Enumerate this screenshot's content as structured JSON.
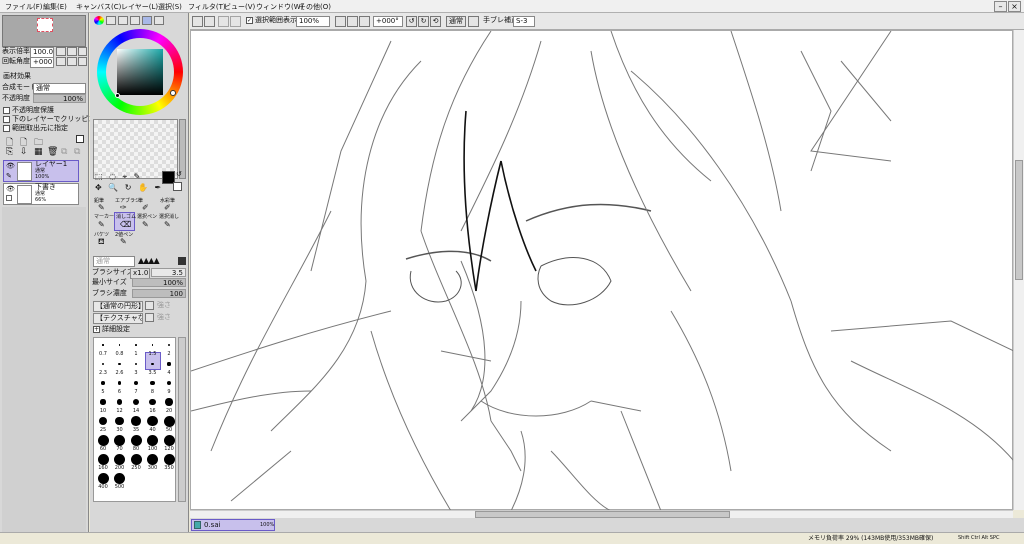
{
  "menu": [
    "ファイル(F)",
    "編集(E)",
    "キャンバス(C)",
    "レイヤー(L)",
    "選択(S)",
    "フィルタ(T)",
    "ビュー(V)",
    "ウィンドウ(W)",
    "その他(O)"
  ],
  "nav": {
    "zoom_label": "表示倍率",
    "zoom_value": "100.0%",
    "rotate_label": "回転角度",
    "rotate_value": "+000°"
  },
  "layer_panel": {
    "title": "画材効果",
    "blend_label": "合成モード",
    "blend_value": "通常",
    "opacity_label": "不透明度",
    "opacity_value": "100%",
    "opt1": "不透明度保護",
    "opt2": "下のレイヤーでクリッピング",
    "opt3": "範囲取出元に指定",
    "layers": [
      {
        "name": "レイヤー1",
        "mode": "通常",
        "opacity": "100%"
      },
      {
        "name": "下書き",
        "mode": "通常",
        "opacity": "66%"
      }
    ]
  },
  "tools": {
    "select_icons": "⬚ ◌ ⌖ ✎",
    "nav_icons": "✥ 🔍 ↻ ✋ ✒",
    "brushes_row1": [
      "鉛筆",
      "エアブラシ",
      "筆",
      "水彩筆"
    ],
    "brushes_row2": [
      "マーカー",
      "消しゴム",
      "選択ペン",
      "選択消し"
    ],
    "brushes_row3": [
      "バケツ",
      "2値ペン"
    ],
    "normal_label": "通常",
    "brush_size_label": "ブラシサイズ",
    "brush_size_mult": "x1.0",
    "brush_size_value": "3.5",
    "min_size_label": "最小サイズ",
    "min_size_value": "100%",
    "density_label": "ブラシ濃度",
    "density_value": "100",
    "shape_value": "【通常の円形】",
    "texture_value": "【テクスチャなし】",
    "strength_label": "強さ",
    "detail_label": "詳細設定",
    "sizes": [
      "0.7",
      "0.8",
      "1",
      "1.5",
      "2",
      "2.3",
      "2.6",
      "3",
      "3.5",
      "4",
      "5",
      "6",
      "7",
      "8",
      "9",
      "10",
      "12",
      "14",
      "16",
      "20",
      "25",
      "30",
      "35",
      "40",
      "50",
      "60",
      "70",
      "80",
      "100",
      "120",
      "160",
      "200",
      "250",
      "300",
      "350",
      "400",
      "500"
    ]
  },
  "toolbar": {
    "sel_display": "選択範囲表示",
    "zoom": "100%",
    "angle": "+000°",
    "mode": "通常",
    "stab_label": "手ブレ補正",
    "stab_value": "S-3"
  },
  "canvas_tab": {
    "name": "0.sai",
    "zoom": "100%"
  },
  "status": {
    "memory": "メモリ負荷率 29% (143MB使用/353MB確保)",
    "keys": "Shift Ctrl Alt SPC"
  }
}
